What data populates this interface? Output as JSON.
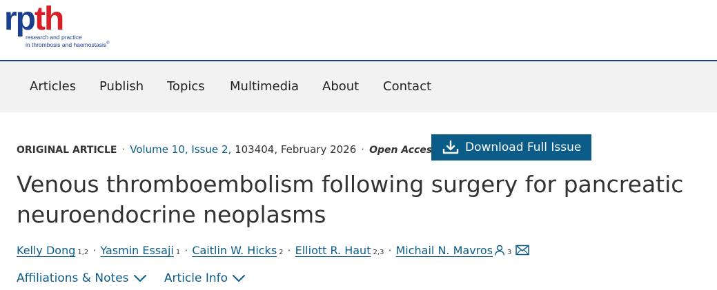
{
  "logo": {
    "mark_part1": "rp",
    "mark_part2": "th",
    "subtitle_line1": "research and practice",
    "subtitle_line2": "in thrombosis and haemostasis",
    "registered": "®",
    "colors": {
      "blue": "#1b3f8f",
      "red": "#d61f26"
    }
  },
  "nav": {
    "items": [
      {
        "label": "Articles"
      },
      {
        "label": "Publish"
      },
      {
        "label": "Topics"
      },
      {
        "label": "Multimedia"
      },
      {
        "label": "About"
      },
      {
        "label": "Contact"
      }
    ]
  },
  "article": {
    "type": "ORIGINAL ARTICLE",
    "volume_issue": "Volume 10, Issue 2,",
    "article_number_date": " 103404, February 2026",
    "access": "Open Access",
    "download_button": "Download Full Issue",
    "download_icon": "download-icon",
    "title": "Venous thromboembolism following surgery for pancreatic neuroendocrine neoplasms",
    "authors": [
      {
        "name": "Kelly Dong",
        "affil": "1,2"
      },
      {
        "name": "Yasmin Essaji",
        "affil": "1"
      },
      {
        "name": "Caitlin W. Hicks",
        "affil": "2"
      },
      {
        "name": "Elliott R. Haut",
        "affil": "2,3"
      },
      {
        "name": "Michail N. Mavros",
        "affil": "3"
      }
    ],
    "affiliations_toggle": "Affiliations & Notes",
    "article_info_toggle": "Article Info"
  },
  "colors": {
    "link": "#0c5c89",
    "button_bg": "#0c5c89",
    "nav_bg": "#f2f2f2",
    "text": "#333333"
  }
}
